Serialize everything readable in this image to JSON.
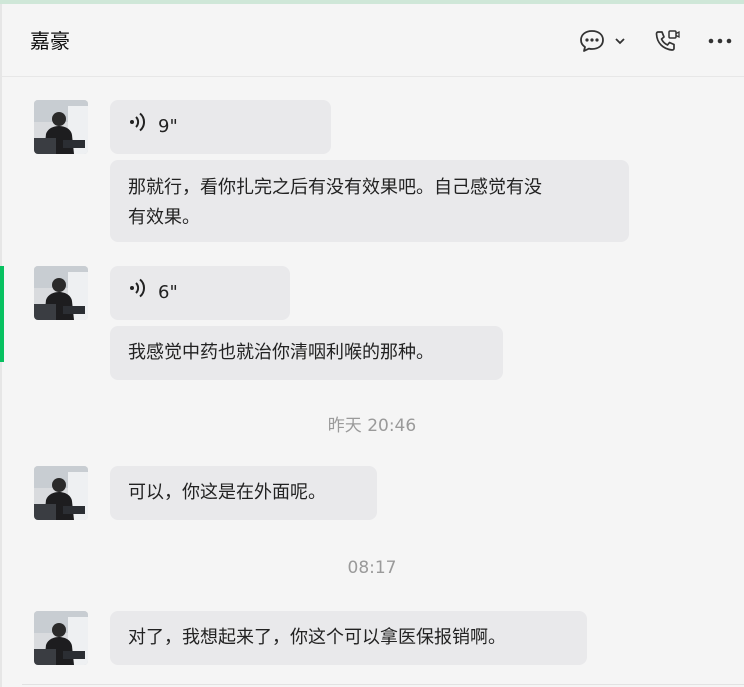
{
  "header": {
    "title": "嘉豪",
    "chat_icon": "chat-bubble-icon",
    "dropdown_icon": "chevron-down-icon",
    "call_icon": "video-call-icon",
    "more_icon": "more-dots-icon"
  },
  "messages": [
    {
      "type": "voice",
      "duration": "9\""
    },
    {
      "type": "text",
      "line1": "那就行，看你扎完之后有没有效果吧。自己感觉有没",
      "line2": "有效果。"
    },
    {
      "type": "voice",
      "duration": "6\""
    },
    {
      "type": "text",
      "text": "我感觉中药也就治你清咽利喉的那种。"
    },
    {
      "type": "timestamp",
      "text": "昨天 20:46"
    },
    {
      "type": "text",
      "text": "可以，你这是在外面呢。"
    },
    {
      "type": "timestamp",
      "text": "08:17"
    },
    {
      "type": "text",
      "text": "对了，我想起来了，你这个可以拿医保报销啊。"
    }
  ],
  "colors": {
    "accent": "#07c160",
    "bubble": "#e9e9eb",
    "background": "#f5f5f5",
    "timestamp": "#9a9a9a"
  }
}
